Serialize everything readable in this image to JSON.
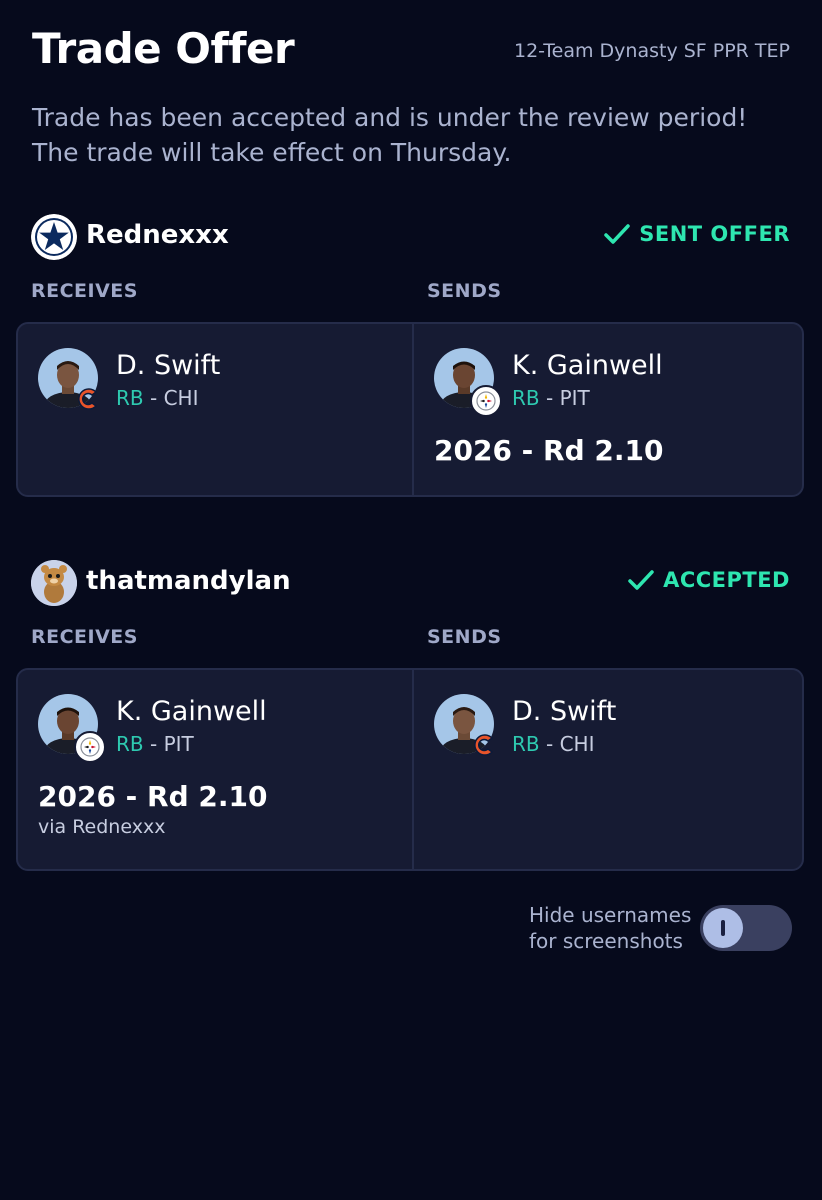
{
  "header": {
    "title": "Trade Offer",
    "league": "12-Team Dynasty SF PPR TEP",
    "status_message": "Trade has been accepted and is under the review period! The trade will take effect on Thursday."
  },
  "colors": {
    "background": "#060a1c",
    "card": "#161b33",
    "accent_green": "#2ee6b0",
    "position_teal": "#2ec9b0"
  },
  "teams": [
    {
      "name": "Rednexxx",
      "avatar_icon": "cowboys-star-icon",
      "status": "SENT OFFER",
      "receives_label": "RECEIVES",
      "sends_label": "SENDS",
      "receives": {
        "player": {
          "name": "D. Swift",
          "pos": "RB",
          "team": "CHI",
          "logo_icon": "bears-logo-icon"
        },
        "pick": "",
        "via": ""
      },
      "sends": {
        "player": {
          "name": "K. Gainwell",
          "pos": "RB",
          "team": "PIT",
          "logo_icon": "steelers-logo-icon"
        },
        "pick": "2026 - Rd 2.10"
      }
    },
    {
      "name": "thatmandylan",
      "avatar_icon": "cartoon-mascot-icon",
      "status": "ACCEPTED",
      "receives_label": "RECEIVES",
      "sends_label": "SENDS",
      "receives": {
        "player": {
          "name": "K. Gainwell",
          "pos": "RB",
          "team": "PIT",
          "logo_icon": "steelers-logo-icon"
        },
        "pick": "2026 - Rd 2.10",
        "via": "via Rednexxx"
      },
      "sends": {
        "player": {
          "name": "D. Swift",
          "pos": "RB",
          "team": "CHI",
          "logo_icon": "bears-logo-icon"
        },
        "pick": ""
      }
    }
  ],
  "settings": {
    "hide_usernames_label": "Hide usernames for screenshots",
    "hide_usernames_on": false
  }
}
